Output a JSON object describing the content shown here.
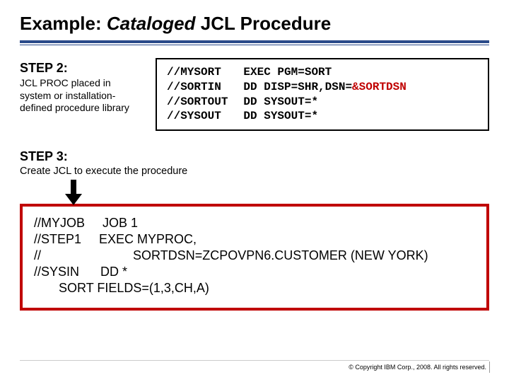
{
  "title": {
    "pre": "Example: ",
    "ital": "Cataloged",
    "post": " JCL Procedure"
  },
  "step2": {
    "head": "STEP 2:",
    "sub": "JCL PROC placed in system or installation-defined procedure library",
    "code": [
      {
        "l": "//MYSORT",
        "r_pre": "EXEC PGM=SORT",
        "r_acc": ""
      },
      {
        "l": "//SORTIN",
        "r_pre": "DD DISP=SHR,DSN=",
        "r_acc": "&SORTDSN"
      },
      {
        "l": "//SORTOUT",
        "r_pre": "DD SYSOUT=*",
        "r_acc": ""
      },
      {
        "l": "//SYSOUT",
        "r_pre": "DD SYSOUT=*",
        "r_acc": ""
      }
    ]
  },
  "step3": {
    "head": "STEP 3:",
    "sub": "Create JCL to execute the procedure",
    "code": [
      "//MYJOB     JOB 1",
      "//STEP1     EXEC MYPROC,",
      "//                          SORTDSN=ZCPOVPN6.CUSTOMER (NEW YORK)",
      "//SYSIN      DD *",
      "       SORT FIELDS=(1,3,CH,A)"
    ]
  },
  "copyright": "© Copyright IBM Corp., 2008. All rights reserved."
}
